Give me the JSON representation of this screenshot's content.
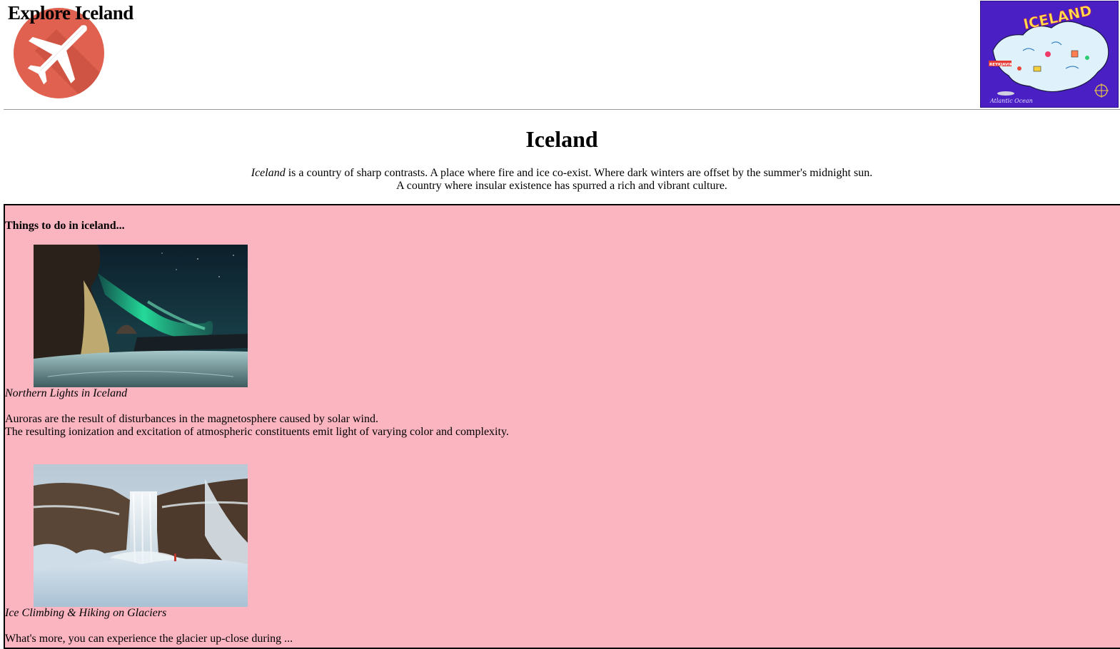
{
  "header": {
    "site_title": "Explore Iceland",
    "logo_icon": "airplane-icon",
    "map_image": "iceland-illustrated-map",
    "map_label": "ICELAND",
    "map_city": "REYKJAVIK",
    "map_sea": "Atlantic Ocean"
  },
  "main": {
    "heading": "Iceland",
    "intro_emphasis": "Iceland",
    "intro_line1_rest": " is a country of sharp contrasts. A place where fire and ice co-exist. Where dark winters are offset by the summer's midnight sun.",
    "intro_line2": "A country where insular existence has spurred a rich and vibrant culture."
  },
  "things_to_do": {
    "heading": "Things to do in iceland...",
    "background_color": "#fab5c1",
    "items": [
      {
        "image": "northern-lights-photo",
        "caption": "Northern Lights in Iceland",
        "description_lines": [
          "Auroras are the result of disturbances in the magnetosphere caused by solar wind.",
          "The resulting ionization and excitation of atmospheric constituents emit light of varying color and complexity."
        ]
      },
      {
        "image": "waterfall-glacier-photo",
        "caption": "Ice Climbing & Hiking on Glaciers",
        "description_lines": [
          "What's more, you can experience the glacier up-close during ..."
        ]
      }
    ]
  }
}
